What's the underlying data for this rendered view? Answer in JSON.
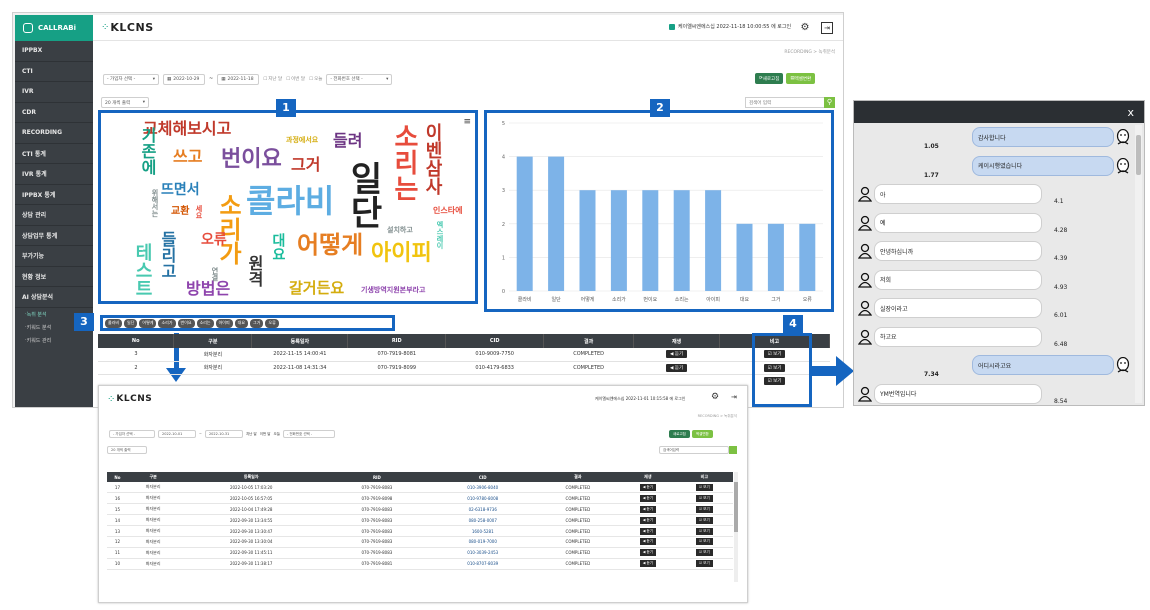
{
  "sidebar": {
    "logo": "CALLRABi",
    "items": [
      "IPPBX",
      "CTI",
      "IVR",
      "CDR",
      "RECORDING",
      "CTI 통계",
      "IVR 통계",
      "IPPBX 통계",
      "상담 관리",
      "상담업무 통계",
      "부가기능",
      "현황 정보",
      "AI 상담분석"
    ],
    "subitems": [
      "녹취 분석",
      "키워드 분석",
      "키워드 관리"
    ]
  },
  "header": {
    "brand": "KLCNS",
    "login_info": "케이엘씨엔에스십 2022-11-18 10:00:55 에 로그인",
    "breadcrumb": "RECORDING > 녹취분석"
  },
  "filters": {
    "select1": "- 가입자 선택 -",
    "date_from": "2022-10-29",
    "date_to": "2022-11-18",
    "quick": [
      "지난 달",
      "이번 달",
      "오늘"
    ],
    "select2": "- 전화번호 선택 -",
    "refresh": "새로고침",
    "excel": "엑셀변환",
    "page_size": "20 개씩 출력",
    "search_placeholder": "검색어 입력"
  },
  "badges": [
    "1",
    "2",
    "3",
    "4"
  ],
  "wordcloud": [
    {
      "t": "교체해보시고",
      "c": "#c0392b"
    },
    {
      "t": "번이요",
      "c": "#7b4f9d"
    },
    {
      "t": "콜라비",
      "c": "#5dade2"
    },
    {
      "t": "일단",
      "c": "#222222"
    },
    {
      "t": "소리는",
      "c": "#e74c3c"
    },
    {
      "t": "소리가",
      "c": "#f39c12"
    },
    {
      "t": "어떻게",
      "c": "#e67e22"
    },
    {
      "t": "아이피",
      "c": "#f1c40f"
    },
    {
      "t": "방법은",
      "c": "#8e44ad"
    },
    {
      "t": "갈거든요",
      "c": "#d4ac0d"
    },
    {
      "t": "이벤삼사",
      "c": "#c0392b"
    },
    {
      "t": "들려",
      "c": "#6c3483"
    },
    {
      "t": "그거",
      "c": "#c0392b"
    },
    {
      "t": "쓰고",
      "c": "#e67e22"
    },
    {
      "t": "뜨면서",
      "c": "#2980b9"
    },
    {
      "t": "기존에",
      "c": "#16a085"
    },
    {
      "t": "테스트",
      "c": "#48c9b0"
    },
    {
      "t": "들리고",
      "c": "#2471a3"
    },
    {
      "t": "오류",
      "c": "#e74c3c"
    },
    {
      "t": "대요",
      "c": "#1abc9c"
    },
    {
      "t": "원격",
      "c": "#333333"
    },
    {
      "t": "인스타에",
      "c": "#e74c3c"
    },
    {
      "t": "과정에서요",
      "c": "#d4ac0d"
    },
    {
      "t": "설치하고",
      "c": "#7f8c8d"
    },
    {
      "t": "기생방역지원본부라고",
      "c": "#8e44ad"
    },
    {
      "t": "위해서는",
      "c": "#7f8c8d"
    },
    {
      "t": "세요",
      "c": "#e74c3c"
    },
    {
      "t": "연결",
      "c": "#7f8c8d"
    },
    {
      "t": "엑스레이",
      "c": "#48c9b0"
    },
    {
      "t": "교환",
      "c": "#d35400"
    }
  ],
  "chart_data": {
    "type": "bar",
    "categories": [
      "콜라비",
      "일단",
      "어떻게",
      "소리가",
      "번이요",
      "소리는",
      "아이피",
      "대요",
      "그거",
      "오류"
    ],
    "values": [
      4,
      4,
      3,
      3,
      3,
      3,
      3,
      2,
      2,
      2
    ],
    "ylim": [
      0,
      5
    ],
    "yticks": [
      "0",
      "1",
      "2",
      "3",
      "4",
      "5"
    ],
    "color": "#7db3e8"
  },
  "tags": [
    "콜라비",
    "일단",
    "어떻게",
    "소리가",
    "번이요",
    "소리는",
    "아이피",
    "대요",
    "그거",
    "오류"
  ],
  "table": {
    "headers": [
      "No",
      "구분",
      "등록일자",
      "RID",
      "CID",
      "결과",
      "재생",
      "비고"
    ],
    "rows": [
      {
        "no": "3",
        "type": "화자분리",
        "date": "2022-11-15 14:00:41",
        "rid": "070-7919-8081",
        "cid": "010-9009-7750",
        "result": "COMPLETED",
        "play": "◀ 듣기",
        "note": "☑ 보기"
      },
      {
        "no": "2",
        "type": "화자분리",
        "date": "2022-11-08 14:31:34",
        "rid": "070-7919-8099",
        "cid": "010-4179-6833",
        "result": "COMPLETED",
        "play": "◀ 듣기",
        "note": "☑ 보기"
      }
    ],
    "extra_note": "☑ 보기"
  },
  "table2": {
    "login_info": "케이엘씨엔에스십 2022-11-01 10:15:58 에 로그인",
    "breadcrumb": "RECORDING > 녹취분석",
    "date_from": "2022-10-01",
    "date_to": "2022-10-31",
    "search_placeholder": "검색어입력",
    "headers": [
      "No",
      "구분",
      "등록일자",
      "RID",
      "CID",
      "결과",
      "재생",
      "비고"
    ],
    "rows": [
      [
        "17",
        "화자분리",
        "2022-10-05 17:03:20",
        "070-7919-8083",
        "010-3906-8040",
        "COMPLETED"
      ],
      [
        "16",
        "화자분리",
        "2022-10-05 16:57:05",
        "070-7919-8098",
        "010-9780-8008",
        "COMPLETED"
      ],
      [
        "15",
        "화자분리",
        "2022-10-04 17:49:28",
        "070-7919-8083",
        "02-6318-9736",
        "COMPLETED"
      ],
      [
        "14",
        "화자분리",
        "2022-09-30 13:34:55",
        "070-7919-8083",
        "080-258-0007",
        "COMPLETED"
      ],
      [
        "13",
        "화자분리",
        "2022-09-30 13:30:47",
        "070-7919-8083",
        "1600-5281",
        "COMPLETED"
      ],
      [
        "12",
        "화자분리",
        "2022-09-30 13:30:04",
        "070-7919-8083",
        "080-019-7000",
        "COMPLETED"
      ],
      [
        "11",
        "화자분리",
        "2022-09-30 11:45:11",
        "070-7919-8083",
        "010-3039-2453",
        "COMPLETED"
      ],
      [
        "10",
        "화자분리",
        "2022-09-30 11:38:17",
        "070-7919-8081",
        "010-8707-8039",
        "COMPLETED"
      ]
    ],
    "play": "◀ 듣기",
    "note": "☑ 보기"
  },
  "chat": {
    "close": "x",
    "messages": [
      {
        "side": "right",
        "text": "감사합니다",
        "time": "1.05"
      },
      {
        "side": "right",
        "text": "케이시행였습니다",
        "time": "1.77"
      },
      {
        "side": "left",
        "text": "아",
        "time": "4.1"
      },
      {
        "side": "left",
        "text": "예",
        "time": "4.28"
      },
      {
        "side": "left",
        "text": "안녕하십니까",
        "time": "4.39"
      },
      {
        "side": "left",
        "text": "저희",
        "time": "4.93"
      },
      {
        "side": "left",
        "text": "실장이라고",
        "time": "6.01"
      },
      {
        "side": "left",
        "text": "하고요",
        "time": "6.48"
      },
      {
        "side": "right",
        "text": "어디시라고요",
        "time": "7.34"
      },
      {
        "side": "left",
        "text": "YM번역입니다",
        "time": "8.54"
      }
    ]
  }
}
